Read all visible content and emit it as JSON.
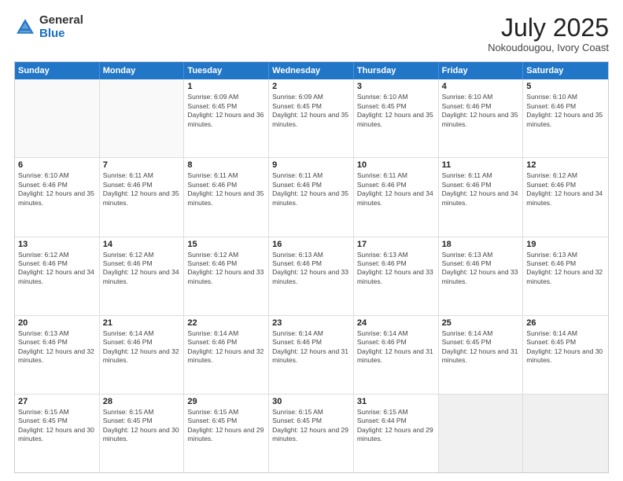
{
  "logo": {
    "general": "General",
    "blue": "Blue"
  },
  "header": {
    "month_year": "July 2025",
    "location": "Nokoudougou, Ivory Coast"
  },
  "weekdays": [
    "Sunday",
    "Monday",
    "Tuesday",
    "Wednesday",
    "Thursday",
    "Friday",
    "Saturday"
  ],
  "rows": [
    [
      {
        "day": "",
        "sunrise": "",
        "sunset": "",
        "daylight": "",
        "empty": true
      },
      {
        "day": "",
        "sunrise": "",
        "sunset": "",
        "daylight": "",
        "empty": true
      },
      {
        "day": "1",
        "sunrise": "Sunrise: 6:09 AM",
        "sunset": "Sunset: 6:45 PM",
        "daylight": "Daylight: 12 hours and 36 minutes."
      },
      {
        "day": "2",
        "sunrise": "Sunrise: 6:09 AM",
        "sunset": "Sunset: 6:45 PM",
        "daylight": "Daylight: 12 hours and 35 minutes."
      },
      {
        "day": "3",
        "sunrise": "Sunrise: 6:10 AM",
        "sunset": "Sunset: 6:45 PM",
        "daylight": "Daylight: 12 hours and 35 minutes."
      },
      {
        "day": "4",
        "sunrise": "Sunrise: 6:10 AM",
        "sunset": "Sunset: 6:46 PM",
        "daylight": "Daylight: 12 hours and 35 minutes."
      },
      {
        "day": "5",
        "sunrise": "Sunrise: 6:10 AM",
        "sunset": "Sunset: 6:46 PM",
        "daylight": "Daylight: 12 hours and 35 minutes."
      }
    ],
    [
      {
        "day": "6",
        "sunrise": "Sunrise: 6:10 AM",
        "sunset": "Sunset: 6:46 PM",
        "daylight": "Daylight: 12 hours and 35 minutes."
      },
      {
        "day": "7",
        "sunrise": "Sunrise: 6:11 AM",
        "sunset": "Sunset: 6:46 PM",
        "daylight": "Daylight: 12 hours and 35 minutes."
      },
      {
        "day": "8",
        "sunrise": "Sunrise: 6:11 AM",
        "sunset": "Sunset: 6:46 PM",
        "daylight": "Daylight: 12 hours and 35 minutes."
      },
      {
        "day": "9",
        "sunrise": "Sunrise: 6:11 AM",
        "sunset": "Sunset: 6:46 PM",
        "daylight": "Daylight: 12 hours and 35 minutes."
      },
      {
        "day": "10",
        "sunrise": "Sunrise: 6:11 AM",
        "sunset": "Sunset: 6:46 PM",
        "daylight": "Daylight: 12 hours and 34 minutes."
      },
      {
        "day": "11",
        "sunrise": "Sunrise: 6:11 AM",
        "sunset": "Sunset: 6:46 PM",
        "daylight": "Daylight: 12 hours and 34 minutes."
      },
      {
        "day": "12",
        "sunrise": "Sunrise: 6:12 AM",
        "sunset": "Sunset: 6:46 PM",
        "daylight": "Daylight: 12 hours and 34 minutes."
      }
    ],
    [
      {
        "day": "13",
        "sunrise": "Sunrise: 6:12 AM",
        "sunset": "Sunset: 6:46 PM",
        "daylight": "Daylight: 12 hours and 34 minutes."
      },
      {
        "day": "14",
        "sunrise": "Sunrise: 6:12 AM",
        "sunset": "Sunset: 6:46 PM",
        "daylight": "Daylight: 12 hours and 34 minutes."
      },
      {
        "day": "15",
        "sunrise": "Sunrise: 6:12 AM",
        "sunset": "Sunset: 6:46 PM",
        "daylight": "Daylight: 12 hours and 33 minutes."
      },
      {
        "day": "16",
        "sunrise": "Sunrise: 6:13 AM",
        "sunset": "Sunset: 6:46 PM",
        "daylight": "Daylight: 12 hours and 33 minutes."
      },
      {
        "day": "17",
        "sunrise": "Sunrise: 6:13 AM",
        "sunset": "Sunset: 6:46 PM",
        "daylight": "Daylight: 12 hours and 33 minutes."
      },
      {
        "day": "18",
        "sunrise": "Sunrise: 6:13 AM",
        "sunset": "Sunset: 6:46 PM",
        "daylight": "Daylight: 12 hours and 33 minutes."
      },
      {
        "day": "19",
        "sunrise": "Sunrise: 6:13 AM",
        "sunset": "Sunset: 6:46 PM",
        "daylight": "Daylight: 12 hours and 32 minutes."
      }
    ],
    [
      {
        "day": "20",
        "sunrise": "Sunrise: 6:13 AM",
        "sunset": "Sunset: 6:46 PM",
        "daylight": "Daylight: 12 hours and 32 minutes."
      },
      {
        "day": "21",
        "sunrise": "Sunrise: 6:14 AM",
        "sunset": "Sunset: 6:46 PM",
        "daylight": "Daylight: 12 hours and 32 minutes."
      },
      {
        "day": "22",
        "sunrise": "Sunrise: 6:14 AM",
        "sunset": "Sunset: 6:46 PM",
        "daylight": "Daylight: 12 hours and 32 minutes."
      },
      {
        "day": "23",
        "sunrise": "Sunrise: 6:14 AM",
        "sunset": "Sunset: 6:46 PM",
        "daylight": "Daylight: 12 hours and 31 minutes."
      },
      {
        "day": "24",
        "sunrise": "Sunrise: 6:14 AM",
        "sunset": "Sunset: 6:46 PM",
        "daylight": "Daylight: 12 hours and 31 minutes."
      },
      {
        "day": "25",
        "sunrise": "Sunrise: 6:14 AM",
        "sunset": "Sunset: 6:45 PM",
        "daylight": "Daylight: 12 hours and 31 minutes."
      },
      {
        "day": "26",
        "sunrise": "Sunrise: 6:14 AM",
        "sunset": "Sunset: 6:45 PM",
        "daylight": "Daylight: 12 hours and 30 minutes."
      }
    ],
    [
      {
        "day": "27",
        "sunrise": "Sunrise: 6:15 AM",
        "sunset": "Sunset: 6:45 PM",
        "daylight": "Daylight: 12 hours and 30 minutes."
      },
      {
        "day": "28",
        "sunrise": "Sunrise: 6:15 AM",
        "sunset": "Sunset: 6:45 PM",
        "daylight": "Daylight: 12 hours and 30 minutes."
      },
      {
        "day": "29",
        "sunrise": "Sunrise: 6:15 AM",
        "sunset": "Sunset: 6:45 PM",
        "daylight": "Daylight: 12 hours and 29 minutes."
      },
      {
        "day": "30",
        "sunrise": "Sunrise: 6:15 AM",
        "sunset": "Sunset: 6:45 PM",
        "daylight": "Daylight: 12 hours and 29 minutes."
      },
      {
        "day": "31",
        "sunrise": "Sunrise: 6:15 AM",
        "sunset": "Sunset: 6:44 PM",
        "daylight": "Daylight: 12 hours and 29 minutes."
      },
      {
        "day": "",
        "sunrise": "",
        "sunset": "",
        "daylight": "",
        "empty": true,
        "shaded": true
      },
      {
        "day": "",
        "sunrise": "",
        "sunset": "",
        "daylight": "",
        "empty": true,
        "shaded": true
      }
    ]
  ]
}
